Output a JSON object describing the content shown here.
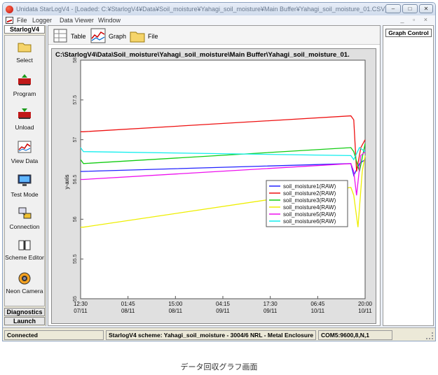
{
  "window": {
    "title": "Unidata StarLogV4 - [Loaded: C:¥StarlogV4¥Data¥Soil_moisture¥Yahagi_soil_moisture¥Main Buffer¥Yahagi_soil_moisture_01.CSV]",
    "buttons": {
      "minimize": "–",
      "maximize": "□",
      "close": "✕"
    }
  },
  "menu": {
    "items": [
      "File",
      "Logger",
      "Data Viewer",
      "Window"
    ],
    "mdi_controls": "_ ▫ ×"
  },
  "sidebar": {
    "header": "StarlogV4",
    "items": [
      {
        "label": "Select",
        "icon": "folder-icon"
      },
      {
        "label": "Program",
        "icon": "program-icon"
      },
      {
        "label": "Unload",
        "icon": "unload-icon"
      },
      {
        "label": "View Data",
        "icon": "chart-icon"
      },
      {
        "label": "Test Mode",
        "icon": "monitor-icon"
      },
      {
        "label": "Connection",
        "icon": "connection-icon"
      },
      {
        "label": "Scheme Editor",
        "icon": "book-icon"
      },
      {
        "label": "Neon Camera",
        "icon": "camera-icon"
      }
    ],
    "diagnostics": "Diagnostics",
    "launch": "Launch"
  },
  "toolbar": {
    "table_label": "Table",
    "graph_label": "Graph",
    "file_label": "File"
  },
  "plot": {
    "title": "C:\\StarlogV4\\Data\\Soil_moisture\\Yahagi_soil_moisture\\Main Buffer\\Yahagi_soil_moisture_01."
  },
  "right_panel": {
    "graph_control": "Graph Control"
  },
  "status": {
    "connection": "Connected",
    "scheme": "StarlogV4 scheme: Yahagi_soil_moisture - 3004/6 NRL - Metal Enclosure",
    "com": "COM5:9600,8,N,1"
  },
  "caption": "データ回収グラフ画面",
  "chart_data": {
    "type": "line",
    "ylabel": "y-axis",
    "xlabel": "",
    "ylim": [
      55,
      58
    ],
    "yticks": [
      "55",
      "55.5",
      "56",
      "56.5",
      "57",
      "57.5",
      "58"
    ],
    "xticks": [
      {
        "time": "12:30",
        "date": "07/11"
      },
      {
        "time": "01:45",
        "date": "08/11"
      },
      {
        "time": "15:00",
        "date": "08/11"
      },
      {
        "time": "04:15",
        "date": "09/11"
      },
      {
        "time": "17:30",
        "date": "09/11"
      },
      {
        "time": "06:45",
        "date": "10/11"
      },
      {
        "time": "20:00",
        "date": "10/11"
      }
    ],
    "legend_position": "right",
    "series": [
      {
        "name": "soil_moisture1(RAW)",
        "color": "#2222ff",
        "points": [
          [
            0,
            56.6
          ],
          [
            0.95,
            56.7
          ],
          [
            0.96,
            56.55
          ],
          [
            0.98,
            56.7
          ],
          [
            1,
            56.75
          ]
        ]
      },
      {
        "name": "soil_moisture2(RAW)",
        "color": "#ee1111",
        "points": [
          [
            0,
            57.1
          ],
          [
            0.01,
            57.1
          ],
          [
            0.95,
            57.3
          ],
          [
            0.96,
            57.25
          ],
          [
            0.97,
            56.6
          ],
          [
            0.985,
            56.9
          ],
          [
            1,
            57.0
          ]
        ]
      },
      {
        "name": "soil_moisture3(RAW)",
        "color": "#11cc11",
        "points": [
          [
            0,
            56.75
          ],
          [
            0.01,
            56.7
          ],
          [
            0.95,
            56.9
          ],
          [
            0.96,
            56.85
          ],
          [
            0.98,
            56.6
          ],
          [
            1,
            56.95
          ]
        ]
      },
      {
        "name": "soil_moisture4(RAW)",
        "color": "#eeee00",
        "points": [
          [
            0,
            55.9
          ],
          [
            0.01,
            55.9
          ],
          [
            0.95,
            56.4
          ],
          [
            0.96,
            56.3
          ],
          [
            0.975,
            55.9
          ],
          [
            0.99,
            56.6
          ],
          [
            1,
            56.8
          ]
        ]
      },
      {
        "name": "soil_moisture5(RAW)",
        "color": "#ee11ee",
        "points": [
          [
            0,
            56.5
          ],
          [
            0.01,
            56.5
          ],
          [
            0.95,
            56.7
          ],
          [
            0.96,
            56.6
          ],
          [
            0.97,
            56.3
          ],
          [
            0.985,
            56.8
          ],
          [
            1,
            56.85
          ]
        ]
      },
      {
        "name": "soil_moisture6(RAW)",
        "color": "#11eeee",
        "points": [
          [
            0,
            56.9
          ],
          [
            0.01,
            56.85
          ],
          [
            0.95,
            56.8
          ],
          [
            0.96,
            56.75
          ],
          [
            0.98,
            56.9
          ],
          [
            1,
            56.85
          ]
        ]
      }
    ]
  }
}
